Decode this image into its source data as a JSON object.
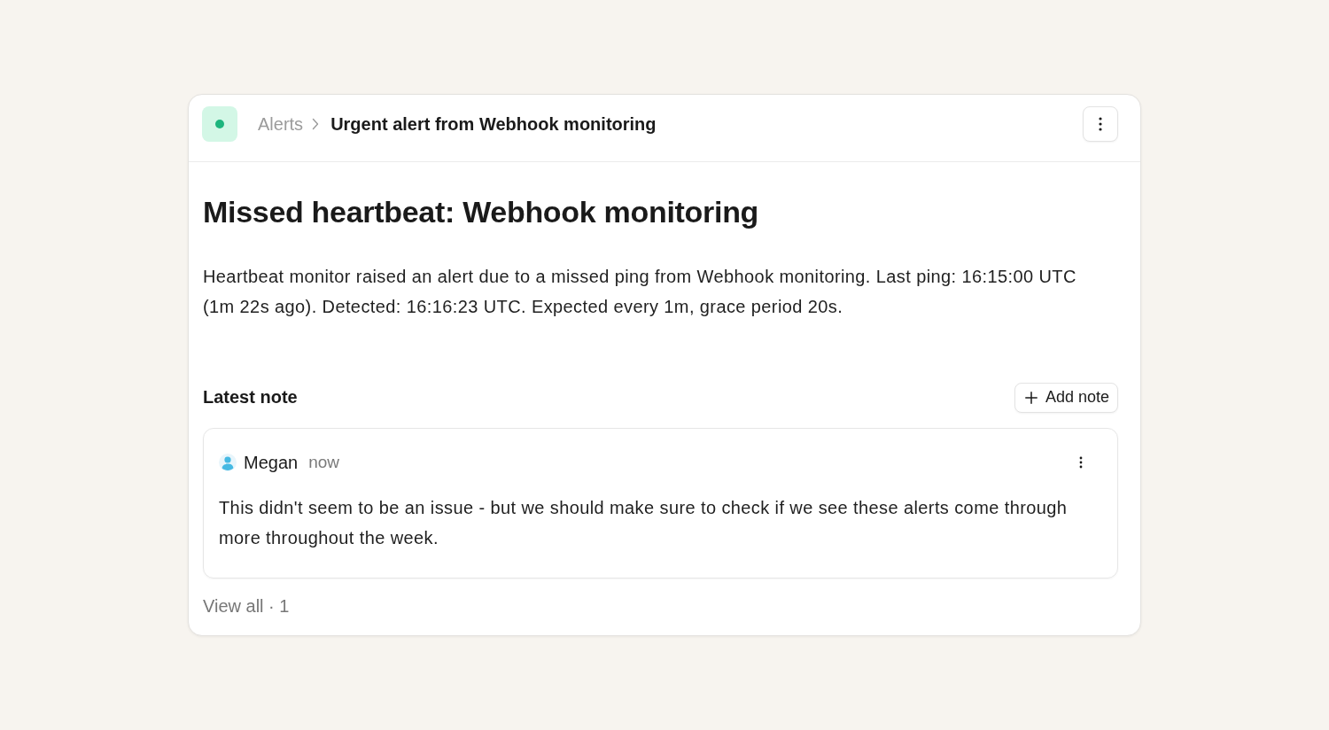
{
  "breadcrumb": [
    {
      "label": "Alerts",
      "current": false
    },
    {
      "label": "Urgent alert from Webhook monitoring",
      "current": true
    }
  ],
  "title": "Missed heartbeat: Webhook monitoring",
  "description": "Heartbeat monitor raised an alert due to a missed ping from Webhook monitoring. Last ping: 16:15:00 UTC (1m 22s ago). Detected: 16:16:23 UTC. Expected every 1m, grace period 20s.",
  "notes": {
    "heading": "Latest note",
    "add_button": "Add note",
    "note": {
      "author": "Megan",
      "time": "now",
      "body": "This didn't seem to be an issue - but we should make sure to check if we see these alerts come through more throughout the week."
    },
    "view_all": "View all · 1"
  }
}
